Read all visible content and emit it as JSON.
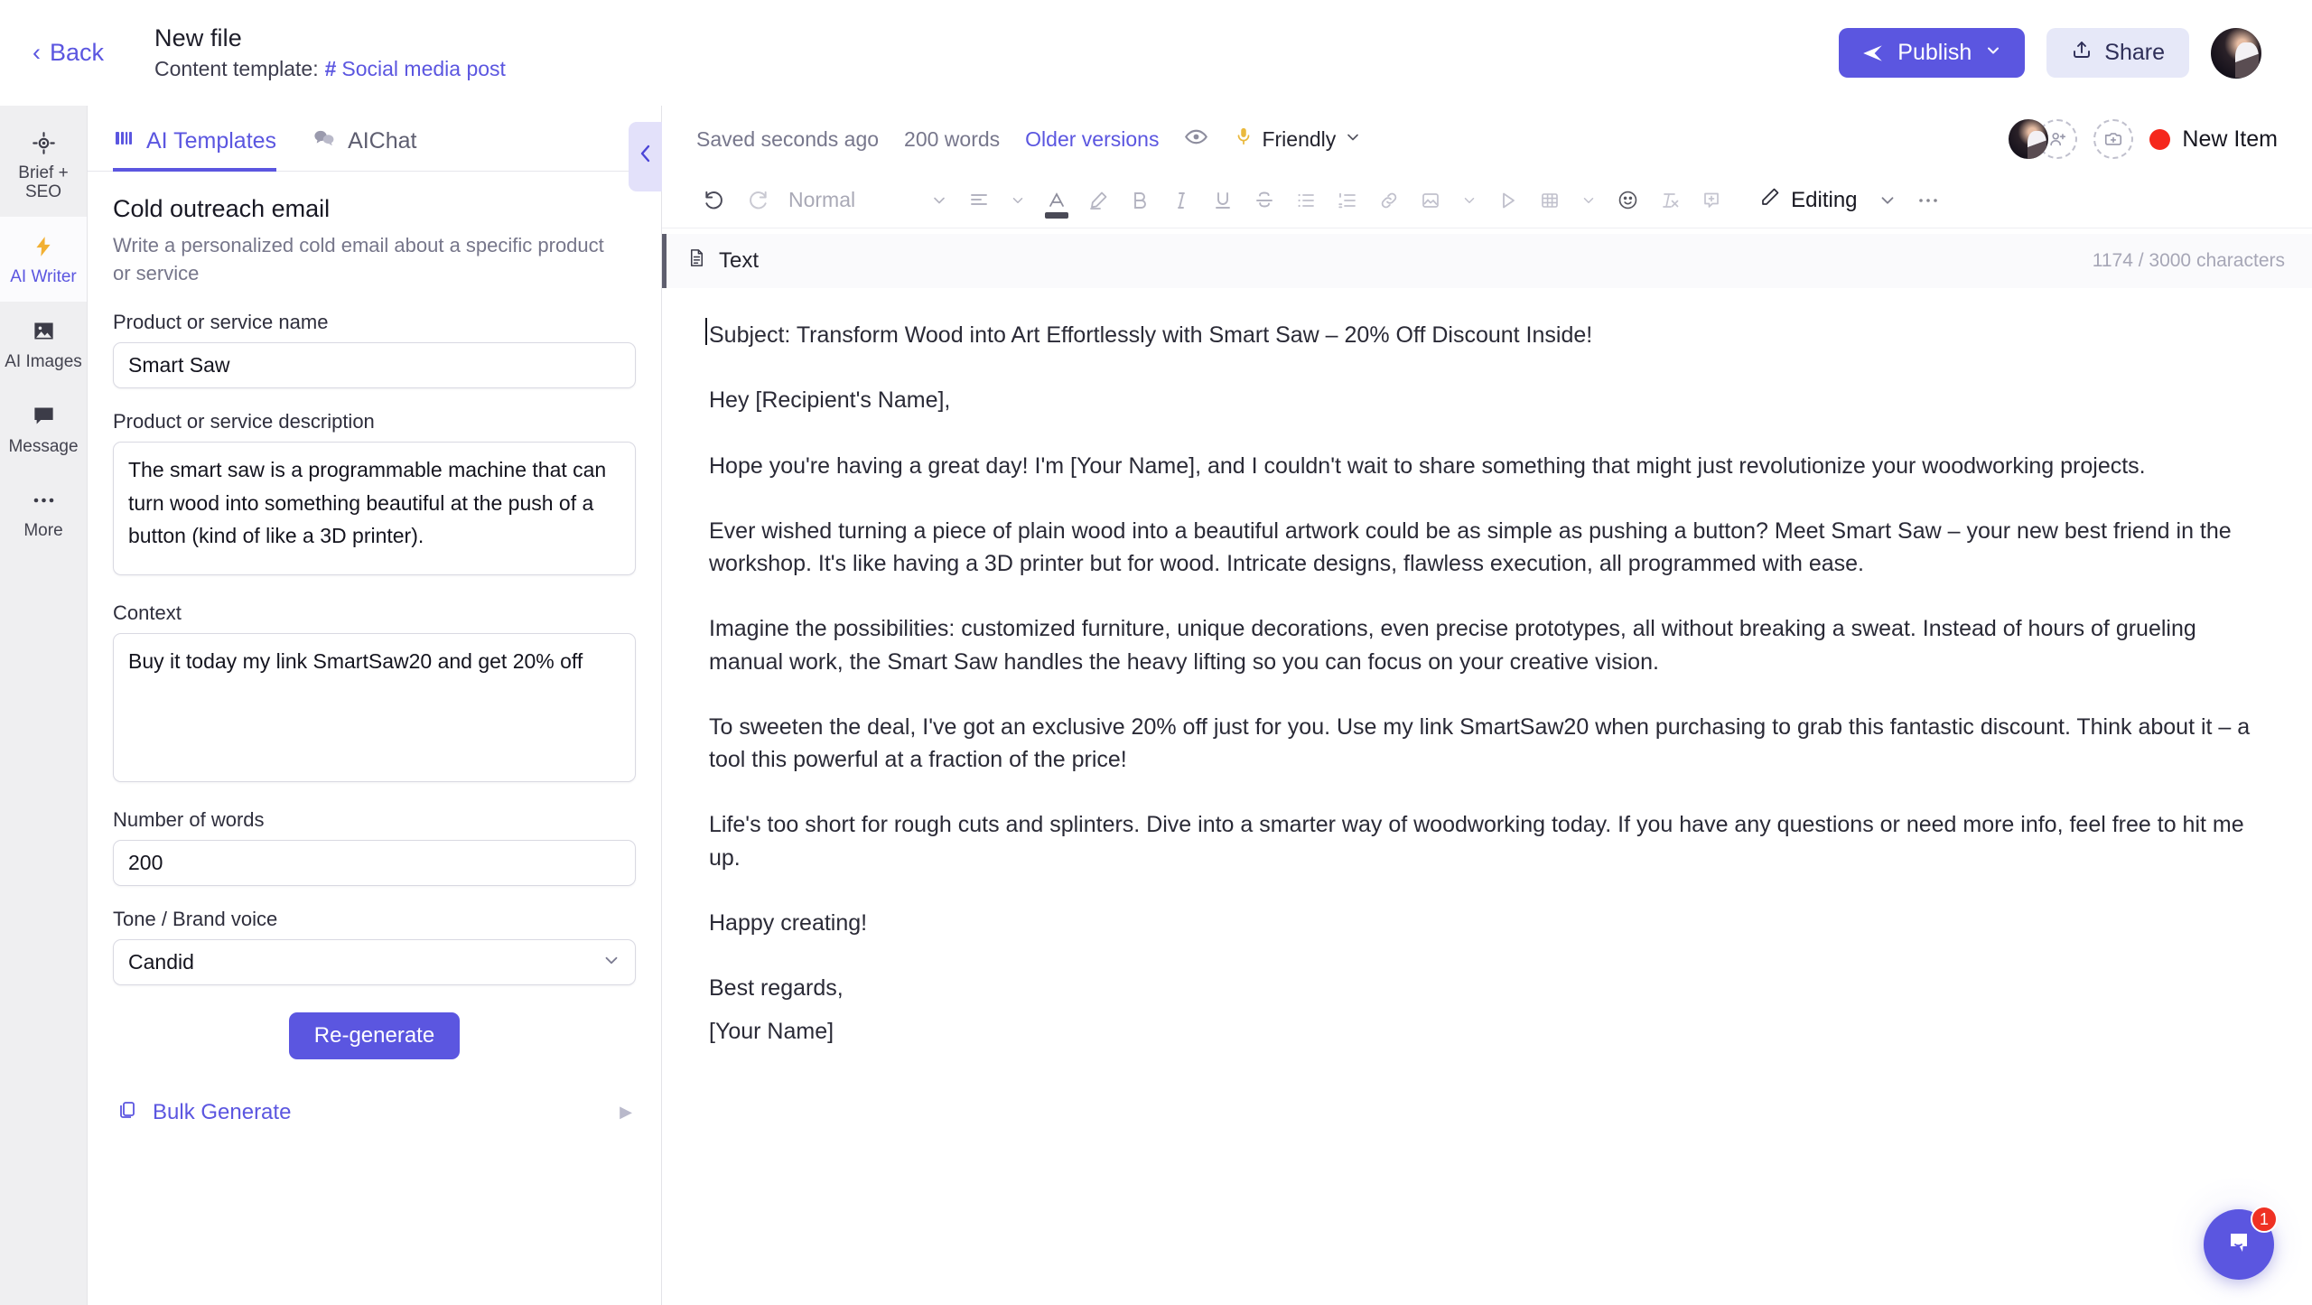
{
  "topbar": {
    "back_label": "Back",
    "file_title": "New file",
    "template_prefix": "Content template:",
    "template_name": "Social media post",
    "hash": "#",
    "publish_label": "Publish",
    "share_label": "Share",
    "accent_color": "#5b56e0",
    "share_bg": "#e6e8f8"
  },
  "rail": {
    "items": [
      {
        "label": "Brief + SEO",
        "icon": "target-icon",
        "active": false
      },
      {
        "label": "AI Writer",
        "icon": "lightning-icon",
        "active": true
      },
      {
        "label": "AI Images",
        "icon": "image-icon",
        "active": false
      },
      {
        "label": "Message",
        "icon": "chat-icon",
        "active": false
      },
      {
        "label": "More",
        "icon": "ellipsis-icon",
        "active": false
      }
    ]
  },
  "panel": {
    "tabs": [
      {
        "label": "AI Templates",
        "icon": "templates-icon",
        "active": true
      },
      {
        "label": "AIChat",
        "icon": "chat-bubbles-icon",
        "active": false
      }
    ],
    "collapse_icon": "chevron-left-icon",
    "template_title": "Cold outreach email",
    "template_description": "Write a personalized cold email about a specific product or service",
    "fields": [
      {
        "label": "Product or service name",
        "value": "Smart Saw",
        "type": "text"
      },
      {
        "label": "Product or service description",
        "value": "The smart saw is a programmable machine that can turn wood into something beautiful at the push of a button (kind of like a 3D printer).",
        "type": "textarea"
      },
      {
        "label": "Context",
        "value": "Buy it today my link SmartSaw20 and get 20% off",
        "type": "textarea"
      },
      {
        "label": "Number of words",
        "value": "200",
        "type": "text"
      },
      {
        "label": "Tone / Brand voice",
        "value": "Candid",
        "type": "select"
      }
    ],
    "regenerate_label": "Re-generate",
    "bulk_generate_label": "Bulk Generate"
  },
  "editor": {
    "saved_status": "Saved seconds ago",
    "word_count": "200 words",
    "older_versions_label": "Older versions",
    "eye_icon": "eye-icon",
    "tone_label": "Friendly",
    "tone_icon": "microphone-icon",
    "new_item_label": "New Item",
    "invite_icon": "add-person-icon",
    "media_icon": "add-media-icon",
    "toolbar": {
      "undo_icon": "undo-icon",
      "redo_icon": "redo-icon",
      "style_label": "Normal",
      "align_icon": "align-left-icon",
      "text_color_icon": "text-color-icon",
      "highlight_icon": "highlighter-icon",
      "bold_icon": "bold-icon",
      "italic_icon": "italic-icon",
      "underline_icon": "underline-icon",
      "strikethrough_icon": "strikethrough-icon",
      "bullet_list_icon": "bullet-list-icon",
      "numbered_list_icon": "numbered-list-icon",
      "link_icon": "link-icon",
      "image_icon": "image-insert-icon",
      "play_icon": "play-icon",
      "table_icon": "table-icon",
      "emoji_icon": "emoji-icon",
      "clear-format_icon": "clear-format-icon",
      "comment_icon": "add-comment-icon",
      "mode_icon": "pencil-icon",
      "mode_label": "Editing",
      "more_icon": "ellipsis-icon",
      "chevron_icon": "chevron-down-icon"
    },
    "block": {
      "title": "Text",
      "icon": "document-icon",
      "char_count": "1174 / 3000 characters"
    },
    "document": {
      "paragraphs": [
        "Subject: Transform Wood into Art Effortlessly with Smart Saw – 20% Off Discount Inside!",
        "Hey [Recipient's Name],",
        "Hope you're having a great day! I'm [Your Name], and I couldn't wait to share something that might just revolutionize your woodworking projects.",
        "Ever wished turning a piece of plain wood into a beautiful artwork could be as simple as pushing a button? Meet Smart Saw – your new best friend in the workshop. It's like having a 3D printer but for wood. Intricate designs, flawless execution, all programmed with ease.",
        "Imagine the possibilities: customized furniture, unique decorations, even precise prototypes, all without breaking a sweat. Instead of hours of grueling manual work, the Smart Saw handles the heavy lifting so you can focus on your creative vision.",
        "To sweeten the deal, I've got an exclusive 20% off just for you. Use my link SmartSaw20 when purchasing to grab this fantastic discount. Think about it – a tool this powerful at a fraction of the price!",
        "Life's too short for rough cuts and splinters. Dive into a smarter way of woodworking today. If you have any questions or need more info, feel free to hit me up.",
        "Happy creating!",
        "Best regards,",
        "[Your Name]"
      ]
    },
    "chat_widget": {
      "badge": "1",
      "icon": "chat-bubble-icon",
      "color": "#5b56e0",
      "badge_color": "#ef3124"
    }
  }
}
